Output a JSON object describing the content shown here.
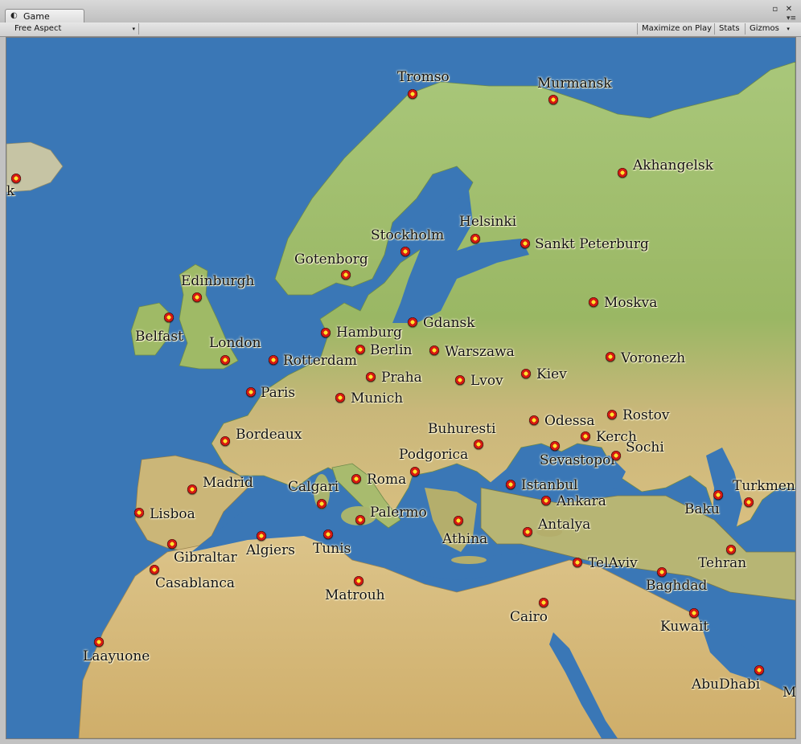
{
  "window": {
    "tab_label": "Game",
    "tab_icon": "unity-game-icon",
    "btn_max": "▫",
    "btn_close": "✕",
    "menu": "▾≡"
  },
  "toolbar": {
    "aspect": "Free Aspect",
    "aspect_arrow": "▾",
    "maximize_on_play": "Maximize on Play",
    "stats": "Stats",
    "gizmos": "Gizmos",
    "gizmos_arrow": "▾"
  },
  "colors": {
    "sea": "#3a77b6",
    "land_north": "#9fbf68",
    "land_south": "#d6bf7c",
    "marker": "#d61a12",
    "marker_center": "#ffe32e"
  },
  "cities": [
    {
      "name": "Tromso",
      "label": "Tromso"
    },
    {
      "name": "Murmansk",
      "label": "Murmansk"
    },
    {
      "name": "Akhangelsk",
      "label": "Akhangelsk"
    },
    {
      "name": "Reykjavik",
      "label": "k"
    },
    {
      "name": "Helsinki",
      "label": "Helsinki"
    },
    {
      "name": "Stockholm",
      "label": "Stockholm"
    },
    {
      "name": "SanktPeterburg",
      "label": "Sankt Peterburg"
    },
    {
      "name": "Gotenborg",
      "label": "Gotenborg"
    },
    {
      "name": "Edinburgh",
      "label": "Edinburgh"
    },
    {
      "name": "Moskva",
      "label": "Moskva"
    },
    {
      "name": "Belfast",
      "label": "Belfast"
    },
    {
      "name": "Hamburg",
      "label": "Hamburg"
    },
    {
      "name": "Gdansk",
      "label": "Gdansk"
    },
    {
      "name": "London",
      "label": "London"
    },
    {
      "name": "Berlin",
      "label": "Berlin"
    },
    {
      "name": "Rotterdam",
      "label": "Rotterdam"
    },
    {
      "name": "Warszawa",
      "label": "Warszawa"
    },
    {
      "name": "Voronezh",
      "label": "Voronezh"
    },
    {
      "name": "Praha",
      "label": "Praha"
    },
    {
      "name": "Lvov",
      "label": "Lvov"
    },
    {
      "name": "Kiev",
      "label": "Kiev"
    },
    {
      "name": "Paris",
      "label": "Paris"
    },
    {
      "name": "Munich",
      "label": "Munich"
    },
    {
      "name": "Odessa",
      "label": "Odessa"
    },
    {
      "name": "Rostov",
      "label": "Rostov"
    },
    {
      "name": "Bordeaux",
      "label": "Bordeaux"
    },
    {
      "name": "Buhuresti",
      "label": "Buhuresti"
    },
    {
      "name": "Kerch",
      "label": "Kerch"
    },
    {
      "name": "Sevastopol",
      "label": "Sevastopol"
    },
    {
      "name": "Sochi",
      "label": "Sochi"
    },
    {
      "name": "Podgorica",
      "label": "Podgorica"
    },
    {
      "name": "Madrid",
      "label": "Madrid"
    },
    {
      "name": "Calgari",
      "label": "Calgari"
    },
    {
      "name": "Roma",
      "label": "Roma"
    },
    {
      "name": "Istanbul",
      "label": "Istanbul"
    },
    {
      "name": "Baku",
      "label": "Baku"
    },
    {
      "name": "Turkmen",
      "label": "Turkmen"
    },
    {
      "name": "Lisboa",
      "label": "Lisboa"
    },
    {
      "name": "Palermo",
      "label": "Palermo"
    },
    {
      "name": "Ankara",
      "label": "Ankara"
    },
    {
      "name": "Athina",
      "label": "Athina"
    },
    {
      "name": "Antalya",
      "label": "Antalya"
    },
    {
      "name": "Gibraltar",
      "label": "Gibraltar"
    },
    {
      "name": "Algiers",
      "label": "Algiers"
    },
    {
      "name": "Tunis",
      "label": "Tunis"
    },
    {
      "name": "Tehran",
      "label": "Tehran"
    },
    {
      "name": "TelAviv",
      "label": "TelAviv"
    },
    {
      "name": "Casablanca",
      "label": "Casablanca"
    },
    {
      "name": "Baghdad",
      "label": "Baghdad"
    },
    {
      "name": "Matrouh",
      "label": "Matrouh"
    },
    {
      "name": "Cairo",
      "label": "Cairo"
    },
    {
      "name": "Kuwait",
      "label": "Kuwait"
    },
    {
      "name": "Laayuone",
      "label": "Laayuone"
    },
    {
      "name": "AbuDhabi",
      "label": "AbuDhabi"
    },
    {
      "name": "Muscat",
      "label": "M"
    }
  ]
}
